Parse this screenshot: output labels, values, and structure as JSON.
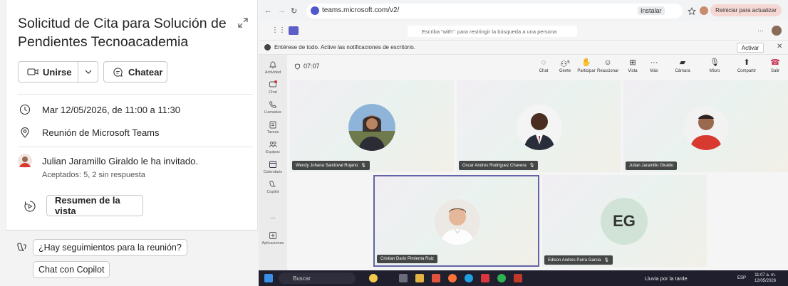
{
  "card": {
    "title": "Solicitud de Cita para Solución de Pendientes Tecnoacademia",
    "join_label": "Unirse",
    "chat_label": "Chatear",
    "datetime": "Mar 12/05/2026, de 11:00 a 11:30",
    "location": "Reunión de Microsoft Teams",
    "invite_text": "Julian Jaramillo Giraldo le ha invitado.",
    "attendance": "Aceptados: 5, 2 sin respuesta",
    "summary_label": "Resumen de la vista"
  },
  "copilot": {
    "suggestion_1": "¿Hay seguimientos para la reunión?",
    "suggestion_2": "Chat con Copilot"
  },
  "browser": {
    "url": "teams.microsoft.com/v2/",
    "install_label": "Instalar",
    "update_label": "Reiniciar para actualizar"
  },
  "teams": {
    "search_placeholder": "Escriba \"with\": para restringir la búsqueda a una persona",
    "notice": "Entérese de todo. Active las notificaciones de escritorio.",
    "activate_label": "Activar",
    "rail": [
      "Actividad",
      "Chat",
      "Llamadas",
      "Tareas",
      "Equipos",
      "Calendario",
      "Copilot",
      "Aplicaciones"
    ],
    "rail_more": "...",
    "timer": "07:07",
    "toolbar": {
      "chat": "Chat",
      "people": "Gente",
      "people_count": "5",
      "participate": "Participar",
      "react": "Reaccionar",
      "view": "Vista",
      "more": "Más",
      "camera": "Cámara",
      "mic": "Micro",
      "share": "Compartir",
      "leave": "Salir"
    },
    "participants": [
      {
        "name": "Wendy Johana Sandoval Rojano"
      },
      {
        "name": "Oscar Andres Rodriguez Chavera"
      },
      {
        "name": "Julian Jaramillo Giraldo"
      },
      {
        "name": "Cristian Dario Pimienta Ruiz"
      },
      {
        "name": "Edison Andres Parra Garcia",
        "initials": "EG"
      }
    ]
  },
  "taskbar": {
    "search_label": "Buscar",
    "weather": "Lluvia por la tarde",
    "lang": "ESP",
    "time": "11:07 a. m.",
    "date": "12/05/2026"
  },
  "colors": {
    "teams_purple": "#6264a7",
    "leave_red": "#c4314b",
    "initials_bg": "#d1e3d6"
  }
}
